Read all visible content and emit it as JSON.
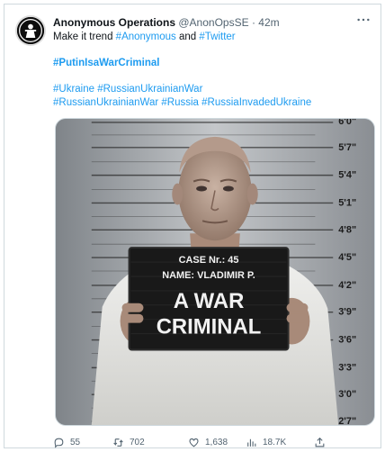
{
  "tweet": {
    "display_name": "Anonymous Operations",
    "handle": "@AnonOpsSE",
    "separator": "·",
    "time": "42m",
    "text_prefix": "Make it trend ",
    "tag_anonymous": "#Anonymous",
    "text_and": " and ",
    "tag_twitter": "#Twitter",
    "tag_war_criminal": "#PutinIsaWarCriminal",
    "tag_ukraine": "#Ukraine",
    "tag_russian_ukrainian_war": "#RussianUkrainianWar",
    "tag_russian_ukrainian_war2": "#RussianUkrainianWar",
    "tag_russia": "#Russia",
    "tag_russia_invaded": "#RussiaInvadedUkraine"
  },
  "media": {
    "placard_line1": "CASE Nr.: 45",
    "placard_line2": "NAME: VLADIMIR P.",
    "placard_line3": "A WAR",
    "placard_line4": "CRIMINAL",
    "height_marks": [
      "6'0\"",
      "5'7\"",
      "5'4\"",
      "5'1\"",
      "4'8\"",
      "4'5\"",
      "4'2\"",
      "3'9\"",
      "3'6\"",
      "3'3\"",
      "3'0\"",
      "2'7\""
    ]
  },
  "actions": {
    "replies": "55",
    "retweets": "702",
    "likes": "1,638",
    "views": "18.7K"
  },
  "colors": {
    "link": "#1d9bf0",
    "muted": "#536471"
  },
  "icons": [
    "more-icon",
    "reply-icon",
    "retweet-icon",
    "like-icon",
    "views-icon",
    "share-icon"
  ]
}
